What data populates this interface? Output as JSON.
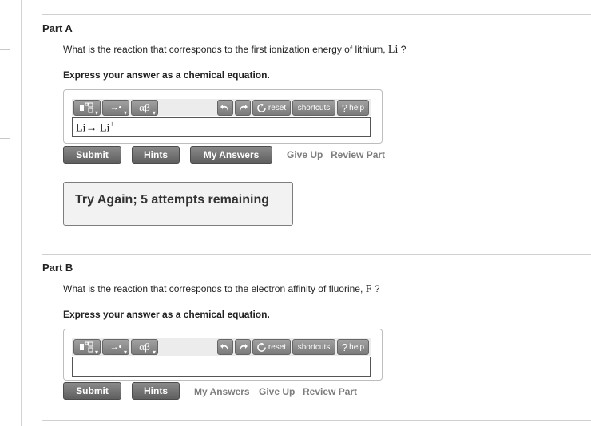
{
  "part_a": {
    "title": "Part A",
    "question_text": "What is the reaction that corresponds to the first ionization energy of lithium,",
    "question_species": "Li",
    "question_end": "?",
    "instruction": "Express your answer as a chemical equation.",
    "toolbar": {
      "reset": "reset",
      "shortcuts": "shortcuts",
      "help": "help"
    },
    "answer": {
      "reactant": "Li",
      "arrow": "→",
      "product": "Li",
      "charge": "+"
    },
    "buttons": {
      "submit": "Submit",
      "hints": "Hints",
      "my_answers": "My Answers"
    },
    "links": {
      "give_up": "Give Up",
      "review_part": "Review Part"
    },
    "feedback": "Try Again; 5 attempts remaining"
  },
  "part_b": {
    "title": "Part B",
    "question_text": "What is the reaction that corresponds to the electron affinity of fluorine,",
    "question_species": "F",
    "question_end": "?",
    "instruction": "Express your answer as a chemical equation.",
    "toolbar": {
      "reset": "reset",
      "shortcuts": "shortcuts",
      "help": "help"
    },
    "answer": "",
    "buttons": {
      "submit": "Submit",
      "hints": "Hints"
    },
    "links": {
      "my_answers": "My Answers",
      "give_up": "Give Up",
      "review_part": "Review Part"
    }
  },
  "toolbar_symbols": {
    "arrow": "→•",
    "greek": "αβ",
    "question_mark": "?"
  },
  "colors": {
    "button_gray": "#6e6e6e",
    "link_gray": "#7d7d7d",
    "feedback_bg": "#f2f2f2"
  }
}
